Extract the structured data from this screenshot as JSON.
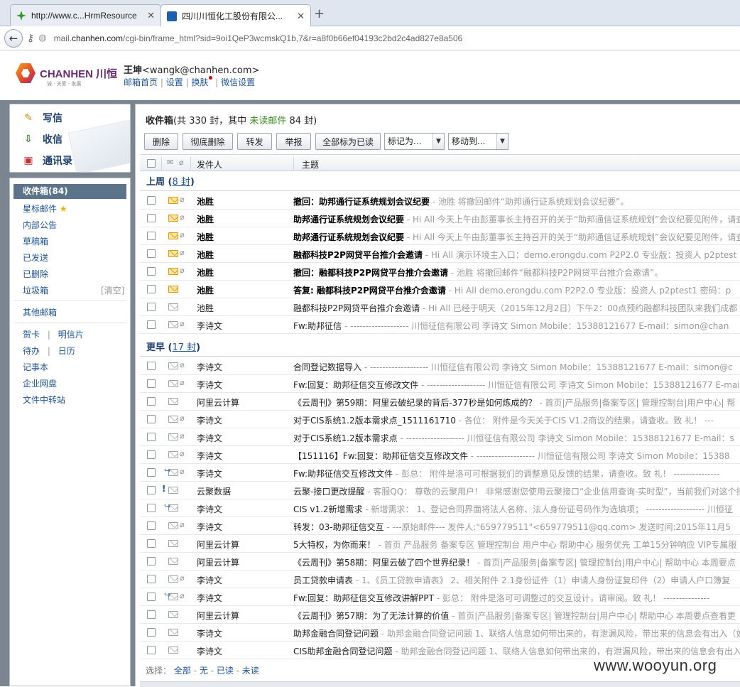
{
  "browser": {
    "tabs": [
      {
        "title": "http://www.c...HrmResource",
        "icon": "green-flower-icon"
      },
      {
        "title": "四川川恒化工股份有限公...",
        "icon": "mail-icon"
      }
    ],
    "url_prefix": "mail.",
    "url_domain": "chanhen.com",
    "url_rest": "/cgi-bin/frame_html?sid=9oi1QeP3wcmskQ1b,7&r=a8f0b66ef04193c2bd2c4ad827e8a506"
  },
  "header": {
    "logo_text": "CHANHEN 川恒",
    "logo_tagline": "诚 · 关爱 · 发展",
    "user_name": "王坤",
    "user_email": "<wangk@chanhen.com>",
    "nav": [
      "邮箱首页",
      "设置",
      "换肤",
      "微信设置"
    ],
    "nav_sep": "|"
  },
  "sidebar": {
    "quick": [
      {
        "label": "写信",
        "icon": "compose-icon"
      },
      {
        "label": "收信",
        "icon": "inbox-download-icon"
      },
      {
        "label": "通讯录",
        "icon": "contacts-icon"
      }
    ],
    "inbox_label": "收件箱(84)",
    "folders": [
      "星标邮件",
      "内部公告",
      "草稿箱",
      "已发送",
      "已删除",
      "垃圾箱"
    ],
    "clear_label": "[清空]",
    "other_mail": "其他邮箱",
    "apps": [
      [
        "贺卡",
        "明信片"
      ],
      [
        "待办",
        "日历"
      ]
    ],
    "tools": [
      "记事本",
      "企业网盘",
      "文件中转站"
    ],
    "sep": "|"
  },
  "main": {
    "title_label": "收件箱",
    "title_prefix": "(共 330 封，其中",
    "title_unread": "未读邮件",
    "title_suffix": "84 封)",
    "toolbar": {
      "buttons": [
        "删除",
        "彻底删除",
        "转发",
        "举报",
        "全部标为已读"
      ],
      "mark_select": "标记为...",
      "move_select": "移动到..."
    },
    "columns": {
      "sender": "发件人",
      "subject": "主题"
    },
    "groups": [
      {
        "label": "上周",
        "count": "8 封"
      },
      {
        "label": "更早",
        "count": "17 封"
      }
    ],
    "rows_lastweek": [
      {
        "sender": "池胜",
        "subject": "撤回：助邦通行证系统规划会议纪要",
        "summary": " - 池胜 将撤回邮件“助邦通行证系统规划会议纪要”。",
        "unread": true,
        "icon": "new",
        "clip": true
      },
      {
        "sender": "池胜",
        "subject": "助邦通行证系统规划会议纪要",
        "summary": " - Hi All 今天上午由彭董事长主持召开的关于“助邦通信证系统规划”会议纪要见附件，请查",
        "unread": true,
        "icon": "new",
        "clip": true
      },
      {
        "sender": "池胜",
        "subject": "助邦通行证系统规划会议纪要",
        "summary": " - Hi All 今天上午由彭董事长主持召开的关于“助邦通信证系统规划”会议纪要见附件，请查",
        "unread": true,
        "icon": "new",
        "clip": true
      },
      {
        "sender": "池胜",
        "subject": "融都科技P2P网贷平台推介会邀请",
        "summary": " - Hi All 演示环境主入口：demo.erongdu.com P2P2.0 专业版：投资人 p2ptest",
        "unread": true,
        "icon": "new",
        "clip": true
      },
      {
        "sender": "池胜",
        "subject": "撤回：融都科技P2P网贷平台推介会邀请",
        "summary": " - 池胜 将撤回邮件“融都科技P2P网贷平台推介会邀请”。",
        "unread": true,
        "icon": "new",
        "clip": true
      },
      {
        "sender": "池胜",
        "subject": "答复: 融都科技P2P网贷平台推介会邀请",
        "summary": " - Hi All demo.erongdu.com P2P2.0 专业版：投资人 p2ptest1 密码：p",
        "unread": true,
        "icon": "new",
        "clip": false
      },
      {
        "sender": "池胜",
        "subject": "融都科技P2P网贷平台推介会邀请",
        "summary": " - Hi All 已经于明天（2015年12月2日）下午2：00点预约融都科技团队来我们成都",
        "unread": false,
        "icon": "read",
        "clip": false
      },
      {
        "sender": "李诗文",
        "subject": "Fw:助邦征信",
        "summary": " - ------------------- 川恒征信有限公司 李诗文 Simon Mobile：15388121677 E-mail：simon@chan",
        "unread": false,
        "icon": "read",
        "clip": true
      }
    ],
    "rows_earlier": [
      {
        "sender": "李诗文",
        "subject": "合同登记数据导入",
        "summary": " - ------------------- 川恒征信有限公司 李诗文 Simon Mobile：15388121677 E-mail：simon@c",
        "icon": "read",
        "clip": true
      },
      {
        "sender": "李诗文",
        "subject": "Fw:回复：助邦征信交互修改文件",
        "summary": " - ------------------- 川恒征信有限公司 李诗文 Simon Mobile：15388121677 E-mail：",
        "icon": "read",
        "clip": true
      },
      {
        "sender": "阿里云计算",
        "subject": "《云周刊》第59期：阿里云破纪录的背后-377秒是如何炼成的？",
        "summary": " - 首页|产品服务|备案专区| 管理控制台|用户中心| 帮",
        "icon": "read",
        "clip": false
      },
      {
        "sender": "李诗文",
        "subject": "对于CIS系统1.2版本需求点_1511161710",
        "summary": " - 各位：      附件是今天关于CIS V1.2商议的结果，请查收。致 礼！ ---",
        "icon": "read",
        "clip": true
      },
      {
        "sender": "李诗文",
        "subject": "对于CIS系统1.2版本需求点",
        "summary": " - ------------------- 川恒征信有限公司 李诗文 Simon Mobile：15388121677 E-mail：s",
        "icon": "read",
        "clip": true
      },
      {
        "sender": "李诗文",
        "subject": "【151116】Fw:回复：助邦征信交互修改文件",
        "summary": " - ------------------- 川恒征信有限公司 李诗文 Simon Mobile：15388",
        "icon": "read",
        "clip": true
      },
      {
        "sender": "李诗文",
        "subject": "Fw:助邦征信交互修改文件",
        "summary": " - 彭总：      附件是洛可可根据我们的调整意见反馈的结果，请查收。致 礼！ ---------------",
        "icon": "fwd",
        "clip": true
      },
      {
        "sender": "云聚数据",
        "subject": "云聚-接口更改提醒",
        "summary": " - 客服QQ： 尊敬的云聚用户！ 非常感谢您使用云聚接口“企业信用查询-实时型”，当前我们对这个接",
        "icon": "read",
        "clip": false,
        "important": true
      },
      {
        "sender": "李诗文",
        "subject": "CIS v1.2新增需求",
        "summary": " - 新增需求： 1、登记合同界面将法人名称、法人身份证号码作为选填项； ------------------- 川恒征",
        "icon": "fwd",
        "clip": false
      },
      {
        "sender": "李诗文",
        "subject": "转发：03-助邦征信交互",
        "summary": " - ---原始邮件--- 发件人:\"659779511\"<659779511@qq.com> 发送时间:2015年11月5",
        "icon": "read",
        "clip": true
      },
      {
        "sender": "阿里云计算",
        "subject": "5大特权，为你而来！",
        "summary": " - 首页 产品服务 备案专区 管理控制台 用户中心 帮助中心 服务优先 工单15分钟响应 VIP专属服",
        "icon": "read",
        "clip": false
      },
      {
        "sender": "阿里云计算",
        "subject": "《云周刊》第58期：阿里云破了四个世界纪录！",
        "summary": " - 首页|产品服务|备案专区| 管理控制台|用户中心| 帮助中心 本周要点",
        "icon": "read",
        "clip": false
      },
      {
        "sender": "李诗文",
        "subject": "员工贷款申请表",
        "summary": " - 1、《员工贷款申请表》 2、相关附件 2.1身份证件（1）申请人身份证复印件（2）申请人户口簿复",
        "icon": "read",
        "clip": true
      },
      {
        "sender": "李诗文",
        "subject": "Fw:回复：助邦征信交互修改讲解PPT",
        "summary": " - 彭总：      附件是洛可可调整过的交互设计，请审阅。致 礼！ ---------------",
        "icon": "fwd",
        "clip": true
      },
      {
        "sender": "阿里云计算",
        "subject": "《云周刊》第57期：为了无法计算的价值",
        "summary": " - 首页|产品服务|备案专区| 管理控制台|用户中心| 帮助中心 本周要点查看更",
        "icon": "read",
        "clip": false
      },
      {
        "sender": "李诗文",
        "subject": "助邦金融合同登记问题",
        "summary": " - 助邦金融合同登记问题 1、联络人信息如何带出来的，有泄漏风险，带出来的信息会有出入（如",
        "icon": "read",
        "clip": false
      },
      {
        "sender": "李诗文",
        "subject": "CIS助邦金融合同登记问题",
        "summary": " - 助邦金融合同登记问题 1、联络人信息如何带出来的，有泄漏风险，带出来的信息会有出入（",
        "icon": "read",
        "clip": false
      }
    ],
    "select_label": "选择：",
    "select_options": [
      "全部",
      "无",
      "已读",
      "未读"
    ],
    "select_sep": " - "
  },
  "watermark": "www.wooyun.org"
}
